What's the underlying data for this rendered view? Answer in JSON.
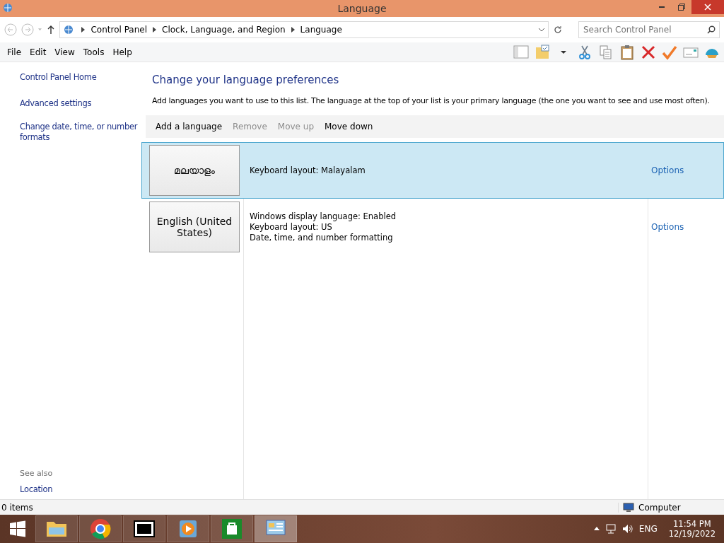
{
  "window": {
    "title": "Language"
  },
  "address_bar": {
    "breadcrumbs": [
      "Control Panel",
      "Clock, Language, and Region",
      "Language"
    ],
    "search_placeholder": "Search Control Panel"
  },
  "menu": [
    "File",
    "Edit",
    "View",
    "Tools",
    "Help"
  ],
  "sidebar": {
    "links": [
      "Control Panel Home",
      "Advanced settings",
      "Change date, time, or number formats"
    ],
    "see_also_heading": "See also",
    "see_also": [
      "Location"
    ]
  },
  "main": {
    "heading": "Change your language preferences",
    "description": "Add languages you want to use to this list. The language at the top of your list is your primary language (the one you want to see and use most often).",
    "actions": [
      {
        "label": "Add a language",
        "disabled": false
      },
      {
        "label": "Remove",
        "disabled": true
      },
      {
        "label": "Move up",
        "disabled": true
      },
      {
        "label": "Move down",
        "disabled": false
      }
    ],
    "languages": [
      {
        "name": "മലയാളം",
        "details": [
          "Keyboard layout: Malayalam"
        ],
        "options": "Options",
        "selected": true
      },
      {
        "name": "English (United States)",
        "details": [
          "Windows display language: Enabled",
          "Keyboard layout: US",
          "Date, time, and number formatting"
        ],
        "options": "Options",
        "selected": false
      }
    ]
  },
  "status_bar": {
    "items": "0 items",
    "location": "Computer"
  },
  "taskbar": {
    "apps": [
      {
        "kind": "explorer",
        "selected": false
      },
      {
        "kind": "chrome",
        "selected": false
      },
      {
        "kind": "zip",
        "selected": false
      },
      {
        "kind": "media",
        "selected": false
      },
      {
        "kind": "store",
        "selected": false
      },
      {
        "kind": "control",
        "selected": true
      }
    ],
    "language": "ENG",
    "time": "11:54 PM",
    "date": "12/19/2022"
  }
}
